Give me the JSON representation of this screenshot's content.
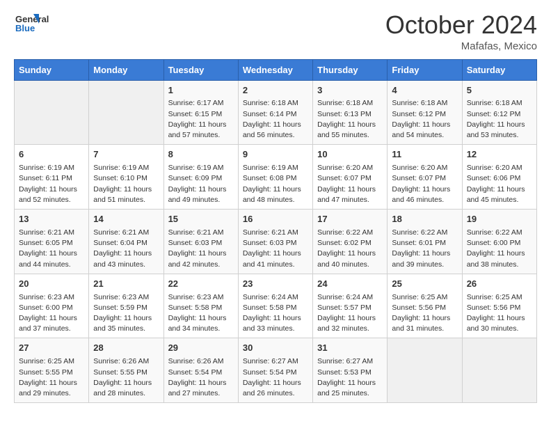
{
  "header": {
    "logo_line1": "General",
    "logo_line2": "Blue",
    "month": "October 2024",
    "location": "Mafafas, Mexico"
  },
  "weekdays": [
    "Sunday",
    "Monday",
    "Tuesday",
    "Wednesday",
    "Thursday",
    "Friday",
    "Saturday"
  ],
  "weeks": [
    [
      {
        "day": "",
        "sunrise": "",
        "sunset": "",
        "daylight": ""
      },
      {
        "day": "",
        "sunrise": "",
        "sunset": "",
        "daylight": ""
      },
      {
        "day": "1",
        "sunrise": "Sunrise: 6:17 AM",
        "sunset": "Sunset: 6:15 PM",
        "daylight": "Daylight: 11 hours and 57 minutes."
      },
      {
        "day": "2",
        "sunrise": "Sunrise: 6:18 AM",
        "sunset": "Sunset: 6:14 PM",
        "daylight": "Daylight: 11 hours and 56 minutes."
      },
      {
        "day": "3",
        "sunrise": "Sunrise: 6:18 AM",
        "sunset": "Sunset: 6:13 PM",
        "daylight": "Daylight: 11 hours and 55 minutes."
      },
      {
        "day": "4",
        "sunrise": "Sunrise: 6:18 AM",
        "sunset": "Sunset: 6:12 PM",
        "daylight": "Daylight: 11 hours and 54 minutes."
      },
      {
        "day": "5",
        "sunrise": "Sunrise: 6:18 AM",
        "sunset": "Sunset: 6:12 PM",
        "daylight": "Daylight: 11 hours and 53 minutes."
      }
    ],
    [
      {
        "day": "6",
        "sunrise": "Sunrise: 6:19 AM",
        "sunset": "Sunset: 6:11 PM",
        "daylight": "Daylight: 11 hours and 52 minutes."
      },
      {
        "day": "7",
        "sunrise": "Sunrise: 6:19 AM",
        "sunset": "Sunset: 6:10 PM",
        "daylight": "Daylight: 11 hours and 51 minutes."
      },
      {
        "day": "8",
        "sunrise": "Sunrise: 6:19 AM",
        "sunset": "Sunset: 6:09 PM",
        "daylight": "Daylight: 11 hours and 49 minutes."
      },
      {
        "day": "9",
        "sunrise": "Sunrise: 6:19 AM",
        "sunset": "Sunset: 6:08 PM",
        "daylight": "Daylight: 11 hours and 48 minutes."
      },
      {
        "day": "10",
        "sunrise": "Sunrise: 6:20 AM",
        "sunset": "Sunset: 6:07 PM",
        "daylight": "Daylight: 11 hours and 47 minutes."
      },
      {
        "day": "11",
        "sunrise": "Sunrise: 6:20 AM",
        "sunset": "Sunset: 6:07 PM",
        "daylight": "Daylight: 11 hours and 46 minutes."
      },
      {
        "day": "12",
        "sunrise": "Sunrise: 6:20 AM",
        "sunset": "Sunset: 6:06 PM",
        "daylight": "Daylight: 11 hours and 45 minutes."
      }
    ],
    [
      {
        "day": "13",
        "sunrise": "Sunrise: 6:21 AM",
        "sunset": "Sunset: 6:05 PM",
        "daylight": "Daylight: 11 hours and 44 minutes."
      },
      {
        "day": "14",
        "sunrise": "Sunrise: 6:21 AM",
        "sunset": "Sunset: 6:04 PM",
        "daylight": "Daylight: 11 hours and 43 minutes."
      },
      {
        "day": "15",
        "sunrise": "Sunrise: 6:21 AM",
        "sunset": "Sunset: 6:03 PM",
        "daylight": "Daylight: 11 hours and 42 minutes."
      },
      {
        "day": "16",
        "sunrise": "Sunrise: 6:21 AM",
        "sunset": "Sunset: 6:03 PM",
        "daylight": "Daylight: 11 hours and 41 minutes."
      },
      {
        "day": "17",
        "sunrise": "Sunrise: 6:22 AM",
        "sunset": "Sunset: 6:02 PM",
        "daylight": "Daylight: 11 hours and 40 minutes."
      },
      {
        "day": "18",
        "sunrise": "Sunrise: 6:22 AM",
        "sunset": "Sunset: 6:01 PM",
        "daylight": "Daylight: 11 hours and 39 minutes."
      },
      {
        "day": "19",
        "sunrise": "Sunrise: 6:22 AM",
        "sunset": "Sunset: 6:00 PM",
        "daylight": "Daylight: 11 hours and 38 minutes."
      }
    ],
    [
      {
        "day": "20",
        "sunrise": "Sunrise: 6:23 AM",
        "sunset": "Sunset: 6:00 PM",
        "daylight": "Daylight: 11 hours and 37 minutes."
      },
      {
        "day": "21",
        "sunrise": "Sunrise: 6:23 AM",
        "sunset": "Sunset: 5:59 PM",
        "daylight": "Daylight: 11 hours and 35 minutes."
      },
      {
        "day": "22",
        "sunrise": "Sunrise: 6:23 AM",
        "sunset": "Sunset: 5:58 PM",
        "daylight": "Daylight: 11 hours and 34 minutes."
      },
      {
        "day": "23",
        "sunrise": "Sunrise: 6:24 AM",
        "sunset": "Sunset: 5:58 PM",
        "daylight": "Daylight: 11 hours and 33 minutes."
      },
      {
        "day": "24",
        "sunrise": "Sunrise: 6:24 AM",
        "sunset": "Sunset: 5:57 PM",
        "daylight": "Daylight: 11 hours and 32 minutes."
      },
      {
        "day": "25",
        "sunrise": "Sunrise: 6:25 AM",
        "sunset": "Sunset: 5:56 PM",
        "daylight": "Daylight: 11 hours and 31 minutes."
      },
      {
        "day": "26",
        "sunrise": "Sunrise: 6:25 AM",
        "sunset": "Sunset: 5:56 PM",
        "daylight": "Daylight: 11 hours and 30 minutes."
      }
    ],
    [
      {
        "day": "27",
        "sunrise": "Sunrise: 6:25 AM",
        "sunset": "Sunset: 5:55 PM",
        "daylight": "Daylight: 11 hours and 29 minutes."
      },
      {
        "day": "28",
        "sunrise": "Sunrise: 6:26 AM",
        "sunset": "Sunset: 5:55 PM",
        "daylight": "Daylight: 11 hours and 28 minutes."
      },
      {
        "day": "29",
        "sunrise": "Sunrise: 6:26 AM",
        "sunset": "Sunset: 5:54 PM",
        "daylight": "Daylight: 11 hours and 27 minutes."
      },
      {
        "day": "30",
        "sunrise": "Sunrise: 6:27 AM",
        "sunset": "Sunset: 5:54 PM",
        "daylight": "Daylight: 11 hours and 26 minutes."
      },
      {
        "day": "31",
        "sunrise": "Sunrise: 6:27 AM",
        "sunset": "Sunset: 5:53 PM",
        "daylight": "Daylight: 11 hours and 25 minutes."
      },
      {
        "day": "",
        "sunrise": "",
        "sunset": "",
        "daylight": ""
      },
      {
        "day": "",
        "sunrise": "",
        "sunset": "",
        "daylight": ""
      }
    ]
  ]
}
